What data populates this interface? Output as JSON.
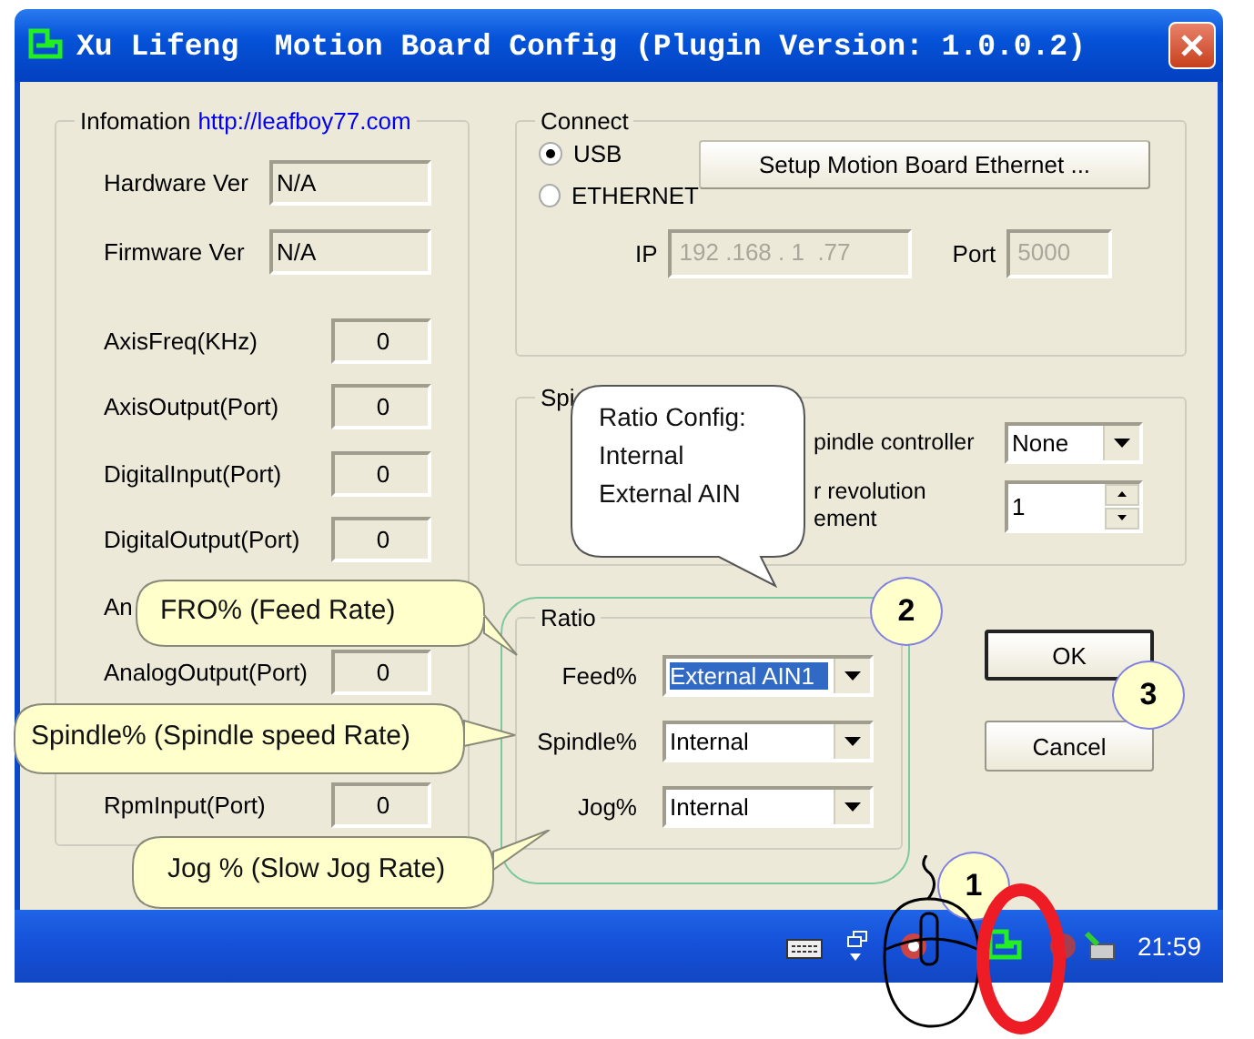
{
  "window": {
    "title": "Xu Lifeng  Motion Board Config (Plugin Version: 1.0.0.2)"
  },
  "information": {
    "title": "Infomation",
    "link": "http://leafboy77.com",
    "versions": [
      {
        "label": "Hardware Ver",
        "value": "N/A"
      },
      {
        "label": "Firmware Ver",
        "value": "N/A"
      }
    ],
    "ports": [
      {
        "label": "AxisFreq(KHz)",
        "value": "0"
      },
      {
        "label": "AxisOutput(Port)",
        "value": "0"
      },
      {
        "label": "DigitalInput(Port)",
        "value": "0"
      },
      {
        "label": "DigitalOutput(Port)",
        "value": "0"
      },
      {
        "label": "An"
      },
      {
        "label": "AnalogOutput(Port)",
        "value": "0"
      },
      {
        "label": "RpmInput(Port)",
        "value": "0"
      }
    ]
  },
  "connect": {
    "title": "Connect",
    "options": [
      {
        "label": "USB",
        "selected": true
      },
      {
        "label": "ETHERNET",
        "selected": false
      }
    ],
    "setup_button": "Setup Motion Board Ethernet ...",
    "ip_label": "IP",
    "ip": "192 .168 . 1  .77",
    "port_label": "Port",
    "port": "5000",
    "disabled": true
  },
  "spindle": {
    "title": "Spi",
    "controller_label": "pindle controller",
    "controller": "None",
    "revolution_lines": [
      "r revolution",
      "ement"
    ],
    "revolution": "1"
  },
  "ratio": {
    "title": "Ratio",
    "rows": [
      {
        "label": "Feed%",
        "value": "External AIN1",
        "highlighted": true
      },
      {
        "label": "Spindle%",
        "value": "Internal",
        "highlighted": false
      },
      {
        "label": "Jog%",
        "value": "Internal",
        "highlighted": false
      }
    ]
  },
  "buttons": [
    {
      "label": "OK",
      "default": true
    },
    {
      "label": "Cancel",
      "default": false
    }
  ],
  "taskbar": {
    "clock": "21:59"
  },
  "callouts": [
    {
      "kind": "note",
      "text": "FRO% (Feed Rate)"
    },
    {
      "kind": "note",
      "text": "Spindle% (Spindle speed Rate)"
    },
    {
      "kind": "note",
      "text": "Jog % (Slow Jog Rate)"
    },
    {
      "kind": "speech",
      "lines": [
        "Ratio Config:",
        "Internal",
        "External AIN"
      ]
    }
  ],
  "markers": [
    "2",
    "3",
    "1"
  ]
}
